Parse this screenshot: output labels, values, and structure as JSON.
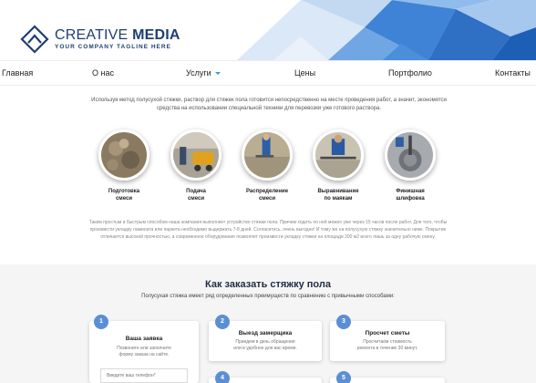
{
  "header": {
    "brand_part1": "CREATIVE",
    "brand_part2": "MEDIA",
    "tagline": "YOUR COMPANY TAGLINE HERE"
  },
  "nav": {
    "items": [
      {
        "label": "Главная"
      },
      {
        "label": "О нас"
      },
      {
        "label": "Услуги",
        "has_dropdown": true
      },
      {
        "label": "Цены"
      },
      {
        "label": "Портфолио"
      },
      {
        "label": "Контакты"
      }
    ]
  },
  "process": {
    "intro": "Используя метод полусухой стяжки, раствор для стяжек пола готовится непосредственно на месте проведения работ, а значит, экономятся средства на использовании специальной техники для перевозки уже готового раствора.",
    "steps": [
      {
        "label_line1": "Подготовка",
        "label_line2": "смеси"
      },
      {
        "label_line1": "Подача",
        "label_line2": "смеси"
      },
      {
        "label_line1": "Распределение",
        "label_line2": "смеси"
      },
      {
        "label_line1": "Выравнивание",
        "label_line2": "по маякам"
      },
      {
        "label_line1": "Финишная",
        "label_line2": "шлифовка"
      }
    ],
    "description": "Таким простым и быстрым способом наша компания выполняет устройство стяжки пола. Причем ходить по ней можно уже через 15 часов после работ. Для того, чтобы произвести укладку ламината или паркета необходимо выдержать 7-8 дней. Согласитесь, очень выгодно! И тому же на полусухую стяжку значительно ниже. Покрытие отличается высокой прочностью, а современное оборудование позволяет произвести укладку стяжки на площади 300 м2 всего лишь за одну рабочую смену."
  },
  "order": {
    "title": "Как заказать стяжку пола",
    "subtitle": "Полусухая стяжка имеет ряд определенных преимуществ по сравнению с привычными способами:",
    "cards": [
      {
        "number": "1",
        "title": "Ваша заявка",
        "text_line1": "Позвоните или заполните",
        "text_line2": "форму заказа на сайте."
      },
      {
        "number": "2",
        "title": "Выезд замерщика",
        "text_line1": "Приедем в день обращения",
        "text_line2": "или в удобное для вас время."
      },
      {
        "number": "3",
        "title": "Просчет сметы",
        "text_line1": "Просчитаем стоимость",
        "text_line2": "ремонта в течение 30 минут."
      },
      {
        "number": "4"
      },
      {
        "number": "5"
      }
    ],
    "phone_placeholder": "Введите ваш телефон*"
  },
  "colors": {
    "brand": "#1f3f73",
    "accent": "#5b8fd4",
    "nav_caret": "#2aa5d6",
    "section_bg": "#f5f5f5"
  }
}
